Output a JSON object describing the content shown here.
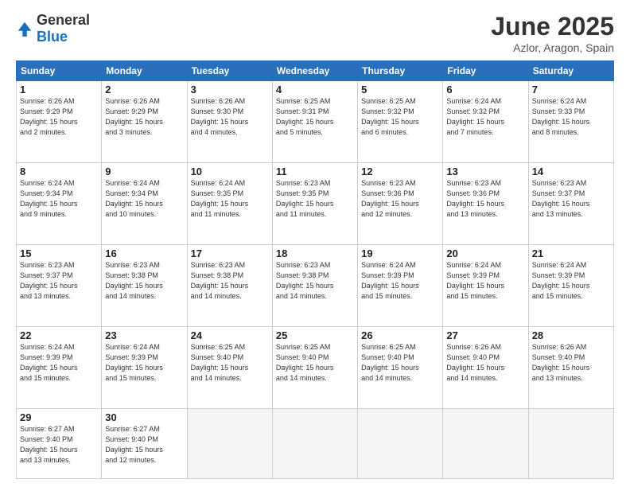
{
  "header": {
    "logo_general": "General",
    "logo_blue": "Blue",
    "title": "June 2025",
    "subtitle": "Azlor, Aragon, Spain"
  },
  "columns": [
    "Sunday",
    "Monday",
    "Tuesday",
    "Wednesday",
    "Thursday",
    "Friday",
    "Saturday"
  ],
  "weeks": [
    [
      {
        "day": "1",
        "info": "Sunrise: 6:26 AM\nSunset: 9:29 PM\nDaylight: 15 hours\nand 2 minutes."
      },
      {
        "day": "2",
        "info": "Sunrise: 6:26 AM\nSunset: 9:29 PM\nDaylight: 15 hours\nand 3 minutes."
      },
      {
        "day": "3",
        "info": "Sunrise: 6:26 AM\nSunset: 9:30 PM\nDaylight: 15 hours\nand 4 minutes."
      },
      {
        "day": "4",
        "info": "Sunrise: 6:25 AM\nSunset: 9:31 PM\nDaylight: 15 hours\nand 5 minutes."
      },
      {
        "day": "5",
        "info": "Sunrise: 6:25 AM\nSunset: 9:32 PM\nDaylight: 15 hours\nand 6 minutes."
      },
      {
        "day": "6",
        "info": "Sunrise: 6:24 AM\nSunset: 9:32 PM\nDaylight: 15 hours\nand 7 minutes."
      },
      {
        "day": "7",
        "info": "Sunrise: 6:24 AM\nSunset: 9:33 PM\nDaylight: 15 hours\nand 8 minutes."
      }
    ],
    [
      {
        "day": "8",
        "info": "Sunrise: 6:24 AM\nSunset: 9:34 PM\nDaylight: 15 hours\nand 9 minutes."
      },
      {
        "day": "9",
        "info": "Sunrise: 6:24 AM\nSunset: 9:34 PM\nDaylight: 15 hours\nand 10 minutes."
      },
      {
        "day": "10",
        "info": "Sunrise: 6:24 AM\nSunset: 9:35 PM\nDaylight: 15 hours\nand 11 minutes."
      },
      {
        "day": "11",
        "info": "Sunrise: 6:23 AM\nSunset: 9:35 PM\nDaylight: 15 hours\nand 11 minutes."
      },
      {
        "day": "12",
        "info": "Sunrise: 6:23 AM\nSunset: 9:36 PM\nDaylight: 15 hours\nand 12 minutes."
      },
      {
        "day": "13",
        "info": "Sunrise: 6:23 AM\nSunset: 9:36 PM\nDaylight: 15 hours\nand 13 minutes."
      },
      {
        "day": "14",
        "info": "Sunrise: 6:23 AM\nSunset: 9:37 PM\nDaylight: 15 hours\nand 13 minutes."
      }
    ],
    [
      {
        "day": "15",
        "info": "Sunrise: 6:23 AM\nSunset: 9:37 PM\nDaylight: 15 hours\nand 13 minutes."
      },
      {
        "day": "16",
        "info": "Sunrise: 6:23 AM\nSunset: 9:38 PM\nDaylight: 15 hours\nand 14 minutes."
      },
      {
        "day": "17",
        "info": "Sunrise: 6:23 AM\nSunset: 9:38 PM\nDaylight: 15 hours\nand 14 minutes."
      },
      {
        "day": "18",
        "info": "Sunrise: 6:23 AM\nSunset: 9:38 PM\nDaylight: 15 hours\nand 14 minutes."
      },
      {
        "day": "19",
        "info": "Sunrise: 6:24 AM\nSunset: 9:39 PM\nDaylight: 15 hours\nand 15 minutes."
      },
      {
        "day": "20",
        "info": "Sunrise: 6:24 AM\nSunset: 9:39 PM\nDaylight: 15 hours\nand 15 minutes."
      },
      {
        "day": "21",
        "info": "Sunrise: 6:24 AM\nSunset: 9:39 PM\nDaylight: 15 hours\nand 15 minutes."
      }
    ],
    [
      {
        "day": "22",
        "info": "Sunrise: 6:24 AM\nSunset: 9:39 PM\nDaylight: 15 hours\nand 15 minutes."
      },
      {
        "day": "23",
        "info": "Sunrise: 6:24 AM\nSunset: 9:39 PM\nDaylight: 15 hours\nand 15 minutes."
      },
      {
        "day": "24",
        "info": "Sunrise: 6:25 AM\nSunset: 9:40 PM\nDaylight: 15 hours\nand 14 minutes."
      },
      {
        "day": "25",
        "info": "Sunrise: 6:25 AM\nSunset: 9:40 PM\nDaylight: 15 hours\nand 14 minutes."
      },
      {
        "day": "26",
        "info": "Sunrise: 6:25 AM\nSunset: 9:40 PM\nDaylight: 15 hours\nand 14 minutes."
      },
      {
        "day": "27",
        "info": "Sunrise: 6:26 AM\nSunset: 9:40 PM\nDaylight: 15 hours\nand 14 minutes."
      },
      {
        "day": "28",
        "info": "Sunrise: 6:26 AM\nSunset: 9:40 PM\nDaylight: 15 hours\nand 13 minutes."
      }
    ],
    [
      {
        "day": "29",
        "info": "Sunrise: 6:27 AM\nSunset: 9:40 PM\nDaylight: 15 hours\nand 13 minutes."
      },
      {
        "day": "30",
        "info": "Sunrise: 6:27 AM\nSunset: 9:40 PM\nDaylight: 15 hours\nand 12 minutes."
      },
      {
        "day": "",
        "info": ""
      },
      {
        "day": "",
        "info": ""
      },
      {
        "day": "",
        "info": ""
      },
      {
        "day": "",
        "info": ""
      },
      {
        "day": "",
        "info": ""
      }
    ]
  ]
}
